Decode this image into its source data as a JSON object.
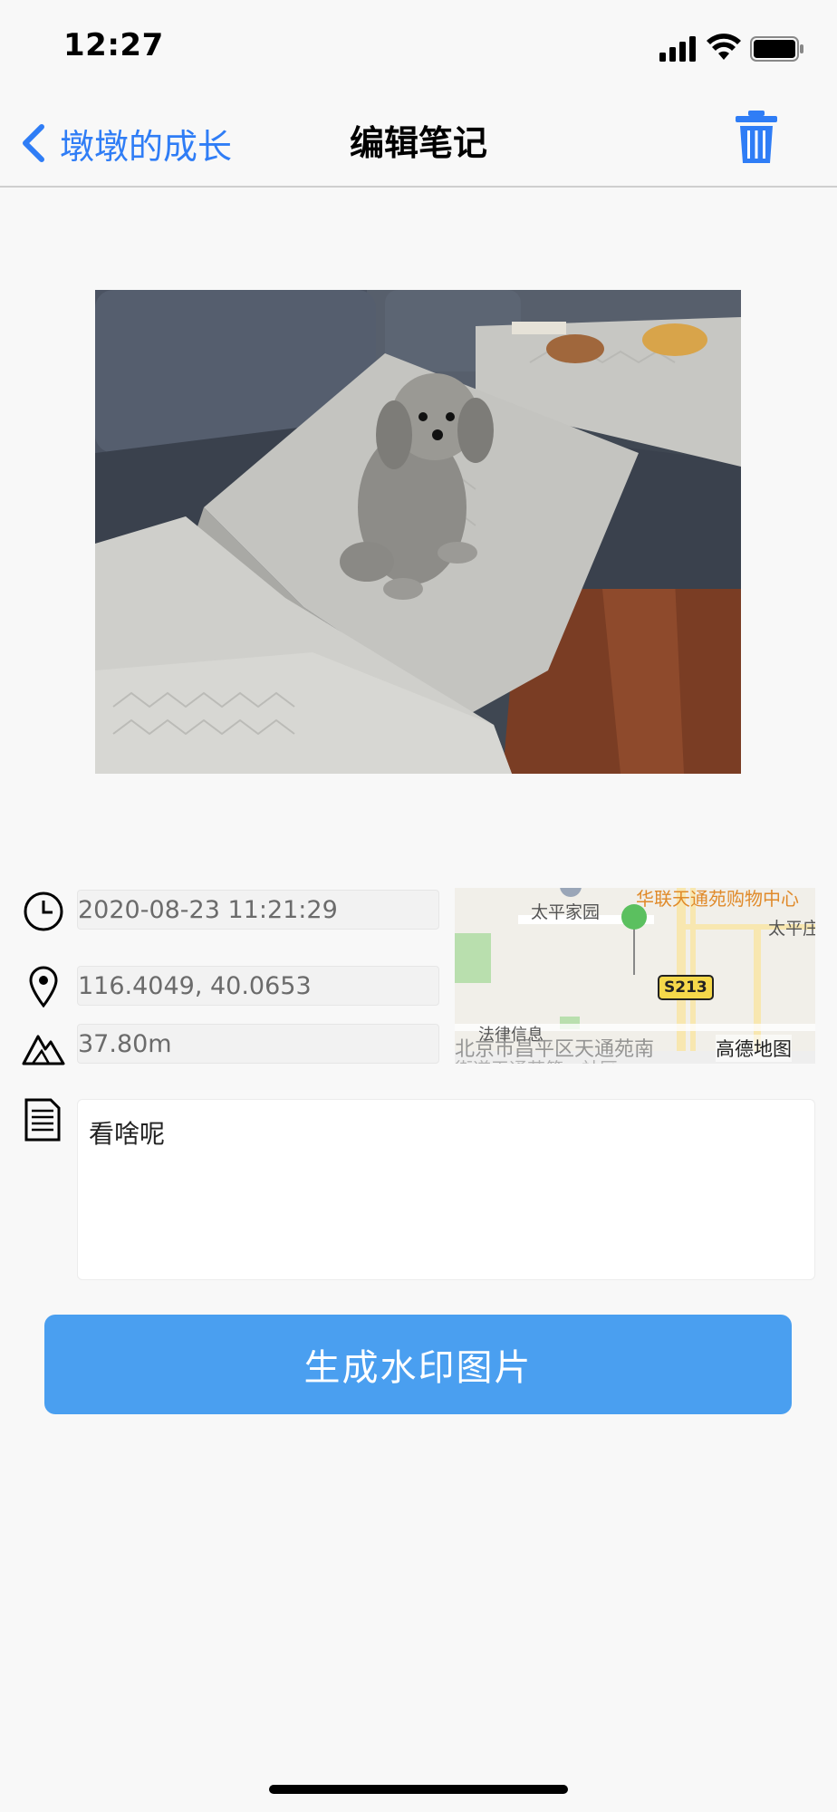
{
  "status_bar": {
    "time": "12:27"
  },
  "nav": {
    "back_label": "墩墩的成长",
    "title": "编辑笔记"
  },
  "info": {
    "datetime": "2020-08-23 11:21:29",
    "location": "116.4049, 40.0653",
    "altitude": "37.80m"
  },
  "map": {
    "label_mall": "华联天通苑购物中心",
    "label_residence": "太平家园",
    "label_taiping": "太平庄",
    "road_badge": "S213",
    "label_law": "法律信息",
    "label_district": "北京市昌平区天通苑南",
    "label_street": "街道天通苑第一社区",
    "provider": "高德地图"
  },
  "note": {
    "text": "看啥呢"
  },
  "button": {
    "generate_label": "生成水印图片"
  },
  "colors": {
    "accent": "#2f7df6",
    "button": "#4a9ff0",
    "pin": "#5bc05f"
  }
}
